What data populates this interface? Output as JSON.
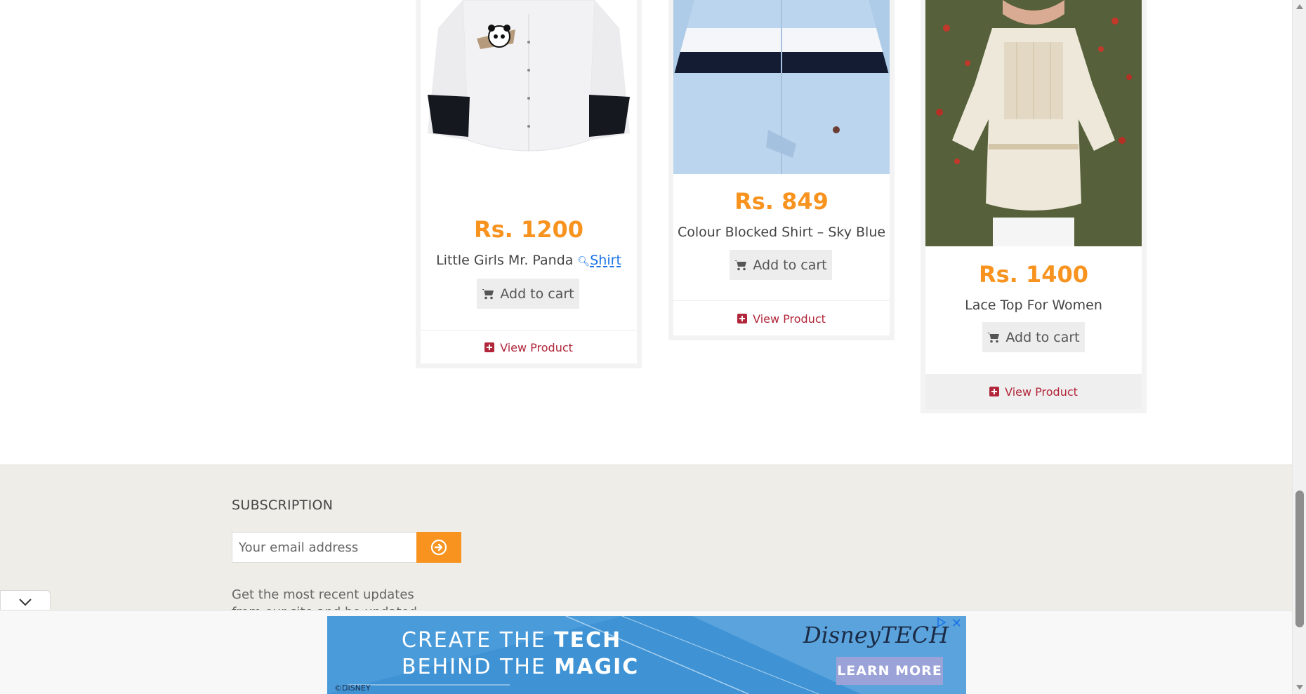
{
  "products": [
    {
      "price": "Rs. 1200",
      "name": "Little Girls Mr. Panda",
      "name_link": "Shirt",
      "cart_label": "Add to cart",
      "view_label": "View Product"
    },
    {
      "price": "Rs. 849",
      "name": "Colour Blocked Shirt – Sky Blue",
      "cart_label": "Add to cart",
      "view_label": "View Product"
    },
    {
      "price": "Rs. 1400",
      "name": "Lace Top For Women",
      "cart_label": "Add to cart",
      "view_label": "View Product"
    }
  ],
  "footer": {
    "subscription_title": "SUBSCRIPTION",
    "email_placeholder": "Your email address",
    "description": "Get the most recent updates from our site and be updated your self..."
  },
  "ad": {
    "headline_line1_a": "CREATE THE ",
    "headline_line1_b": "TECH",
    "headline_line2_a": "BEHIND THE ",
    "headline_line2_b": "MAGIC",
    "brand": "DisneyTECH",
    "cta": "LEARN MORE",
    "copyright": "©DISNEY",
    "close": "✕"
  },
  "colors": {
    "price": "#f7931e",
    "view_link": "#b1263a",
    "submit_button": "#f7931e",
    "ad_background": "#3f93d4"
  }
}
